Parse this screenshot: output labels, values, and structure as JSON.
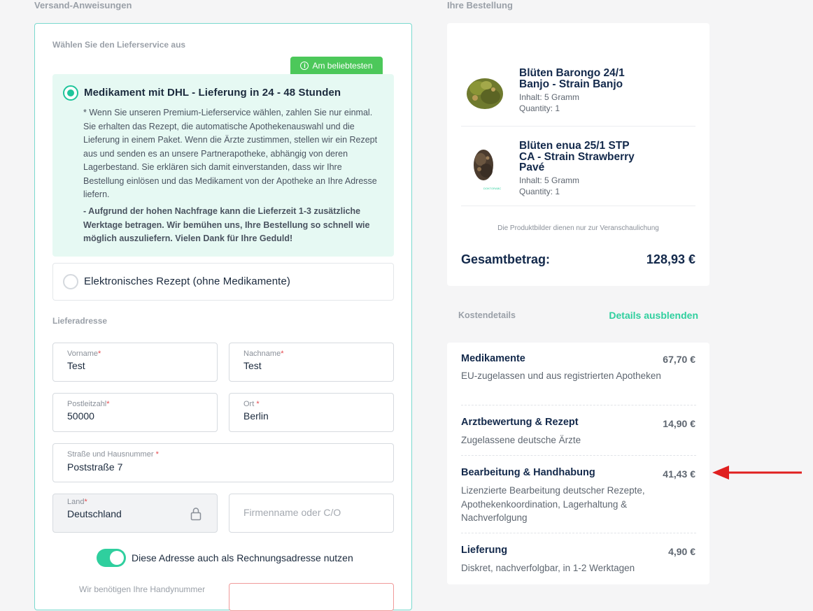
{
  "shipping": {
    "section_title": "Versand-Anweisungen",
    "service_label": "Wählen Sie den Lieferservice aus",
    "badge": "Am beliebtesten",
    "option1": {
      "title": "Medikament mit DHL - Lieferung in 24 - 48 Stunden",
      "description": "* Wenn Sie unseren Premium-Lieferservice wählen, zahlen Sie nur einmal. Sie erhalten das Rezept, die automatische Apothekenauswahl und die Lieferung in einem Paket. Wenn die Ärzte zustimmen, stellen wir ein Rezept aus und senden es an unsere Partnerapotheke, abhängig von deren Lagerbestand. Sie erklären sich damit einverstanden, dass wir Ihre Bestellung einlösen und das Medikament von der Apotheke an Ihre Adresse liefern.",
      "note": "- Aufgrund der hohen Nachfrage kann die Lieferzeit 1-3 zusätzliche Werktage betragen. Wir bemühen uns, Ihre Bestellung so schnell wie möglich auszuliefern. Vielen Dank für Ihre Geduld!",
      "selected": true
    },
    "option2": {
      "title": "Elektronisches Rezept (ohne Medikamente)",
      "selected": false
    },
    "address_label": "Lieferadresse",
    "fields": {
      "vorname": {
        "label": "Vorname",
        "req": "*",
        "value": "Test"
      },
      "nachname": {
        "label": "Nachname",
        "req": "*",
        "value": "Test"
      },
      "plz": {
        "label": "Postleitzahl",
        "req": "*",
        "value": "50000"
      },
      "ort": {
        "label": "Ort ",
        "req": "*",
        "value": "Berlin"
      },
      "strasse": {
        "label": "Straße und Hausnummer ",
        "req": "*",
        "value": "Poststraße 7"
      },
      "land": {
        "label": "Land",
        "req": "*",
        "value": "Deutschland"
      },
      "firma": {
        "placeholder": "Firmenname oder C/O"
      }
    },
    "billing_toggle_label": "Diese Adresse auch als Rechnungsadresse nutzen",
    "billing_toggle_on": true,
    "phone_hint": "Wir benötigen Ihre Handynummer"
  },
  "order": {
    "section_title": "Ihre Bestellung",
    "products": [
      {
        "name": "Blüten Barongo 24/1 Banjo - Strain Banjo",
        "content": "Inhalt: 5 Gramm",
        "quantity": "Quantity: 1",
        "image": "cannabis-bud-green"
      },
      {
        "name": "Blüten enua 25/1 STP CA - Strain Strawberry Pavé",
        "content": "Inhalt: 5 Gramm",
        "quantity": "Quantity: 1",
        "image": "cannabis-bud-purple",
        "brand_mark": "DOKTORABC"
      }
    ],
    "disclaimer": "Die Produktbilder dienen nur zur Veranschaulichung",
    "total_label": "Gesamtbetrag:",
    "total_value": "128,93 €"
  },
  "costs": {
    "section_title": "Kostendetails",
    "toggle_label": "Details ausblenden",
    "items": [
      {
        "name": "Medikamente",
        "price": "67,70 €",
        "desc": "EU-zugelassen und aus registrierten Apotheken"
      },
      {
        "name": "Arztbewertung & Rezept",
        "price": "14,90 €",
        "desc": "Zugelassene deutsche Ärzte"
      },
      {
        "name": "Bearbeitung & Handhabung",
        "price": "41,43 €",
        "desc": "Lizenzierte Bearbeitung deutscher Rezepte, Apothekenkoordination, Lagerhaltung & Nachverfolgung"
      },
      {
        "name": "Lieferung",
        "price": "4,90 €",
        "desc": "Diskret, nachverfolgbar, in 1-2 Werktagen"
      }
    ]
  },
  "colors": {
    "accent": "#2fcf9e",
    "badge": "#4cc85a",
    "arrow": "#e02020"
  }
}
